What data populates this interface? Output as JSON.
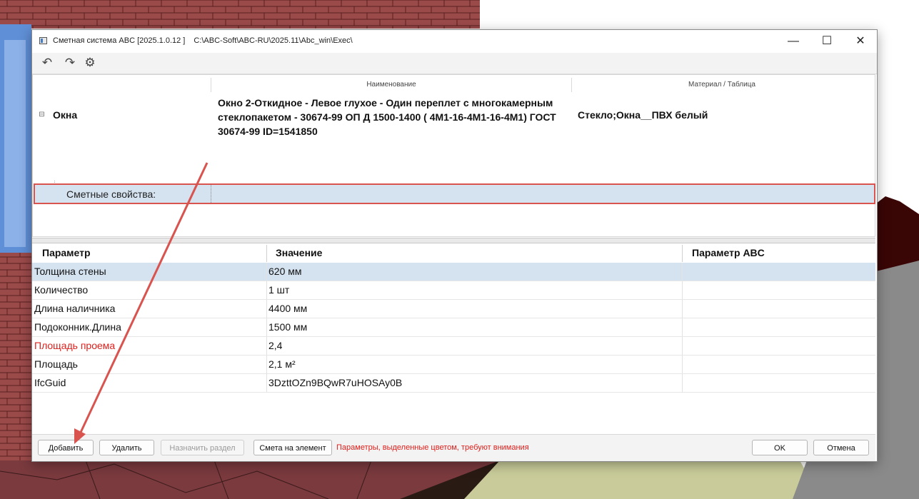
{
  "window": {
    "title": "Сметная система ABC [2025.1.0.12 ]",
    "path": "C:\\ABC-Soft\\ABC-RU\\2025.11\\Abc_win\\Exec\\",
    "minimize_glyph": "—",
    "maximize_glyph": "☐",
    "close_glyph": "✕"
  },
  "toolbar": {
    "undo_icon": "undo-icon",
    "redo_icon": "redo-icon",
    "settings_icon": "gears-icon",
    "undo_glyph": "↶",
    "redo_glyph": "↷",
    "settings_glyph": "⚙"
  },
  "tree": {
    "col_name": "Наименование",
    "col_material": "Материал / Таблица",
    "expander_glyph": "⊟",
    "okna": {
      "label": "Окна",
      "name": "Окно 2-Откидное - Левое глухое - Один переплет с многокамерным стеклопакетом - 30674-99 ОП Д  1500-1400  ( 4М1-16-4М1-16-4М1)    ГОСТ 30674-99  ID=1541850",
      "material": "Стекло;Окна__ПВХ белый"
    },
    "smet": {
      "label": "Сметные свойства:"
    }
  },
  "props": {
    "headers": [
      "Параметр",
      "Значение",
      "Параметр ABC"
    ],
    "rows": [
      {
        "param": "Толщина стены",
        "value": "620  мм",
        "abc": "",
        "selected": true,
        "warn": false
      },
      {
        "param": "Количество",
        "value": "1  шт",
        "abc": "",
        "selected": false,
        "warn": false
      },
      {
        "param": "Длина наличника",
        "value": "4400  мм",
        "abc": "",
        "selected": false,
        "warn": false
      },
      {
        "param": "Подоконник.Длина",
        "value": "1500  мм",
        "abc": "",
        "selected": false,
        "warn": false
      },
      {
        "param": "Площадь проема",
        "value": "2,4",
        "abc": "",
        "selected": false,
        "warn": true
      },
      {
        "param": "Площадь",
        "value": "2,1  м²",
        "abc": "",
        "selected": false,
        "warn": false
      },
      {
        "param": "IfcGuid",
        "value": "3DzttOZn9BQwR7uHOSAy0B",
        "abc": "",
        "selected": false,
        "warn": false
      }
    ]
  },
  "bottom": {
    "add": "Добавить",
    "delete": "Удалить",
    "assign_section": "Назначить раздел",
    "estimate_on_element": "Смета на элемент",
    "hint": "Параметры, выделенные цветом, требуют внимания",
    "ok": "OK",
    "cancel": "Отмена"
  },
  "colors": {
    "selection": "#d5e3f1",
    "warning": "#e0201c",
    "annotation": "#d9534f"
  }
}
